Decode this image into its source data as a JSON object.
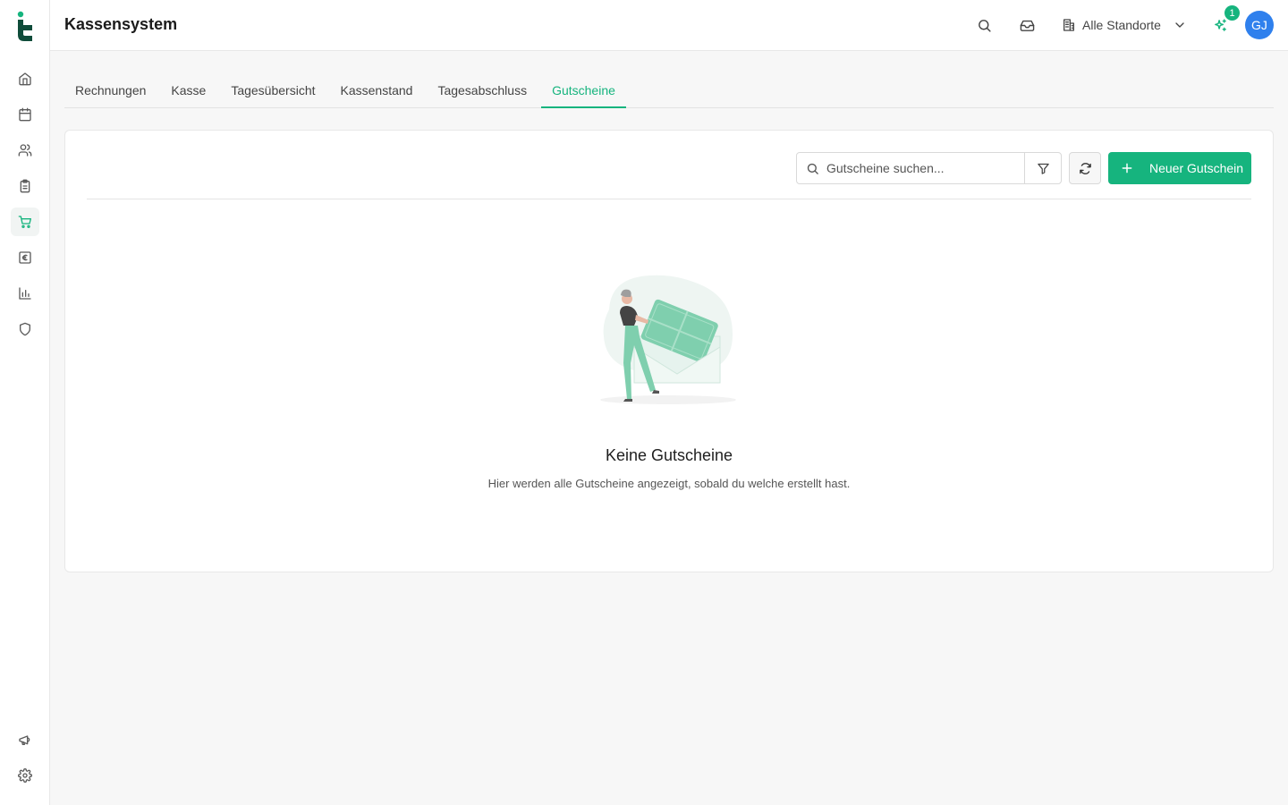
{
  "app": {
    "title": "Kassensystem"
  },
  "header": {
    "location_label": "Alle Standorte",
    "notification_count": "1",
    "avatar_initials": "GJ"
  },
  "sidebar": {
    "items": [
      {
        "icon": "home-icon"
      },
      {
        "icon": "calendar-icon"
      },
      {
        "icon": "users-icon"
      },
      {
        "icon": "clipboard-icon"
      },
      {
        "icon": "cart-icon",
        "active": true
      },
      {
        "icon": "euro-icon"
      },
      {
        "icon": "bar-chart-icon"
      },
      {
        "icon": "shield-icon"
      }
    ],
    "bottom_items": [
      {
        "icon": "megaphone-icon"
      },
      {
        "icon": "gear-icon"
      }
    ]
  },
  "tabs": [
    {
      "label": "Rechnungen"
    },
    {
      "label": "Kasse"
    },
    {
      "label": "Tagesübersicht"
    },
    {
      "label": "Kassenstand"
    },
    {
      "label": "Tagesabschluss"
    },
    {
      "label": "Gutscheine",
      "active": true
    }
  ],
  "toolbar": {
    "search_placeholder": "Gutscheine suchen...",
    "new_button_label": "Neuer Gutschein"
  },
  "empty_state": {
    "title": "Keine Gutscheine",
    "description": "Hier werden alle Gutscheine angezeigt, sobald du welche erstellt hast."
  },
  "colors": {
    "accent": "#16b47e",
    "avatar": "#2f80ed",
    "logo": "#0f4c3a"
  }
}
